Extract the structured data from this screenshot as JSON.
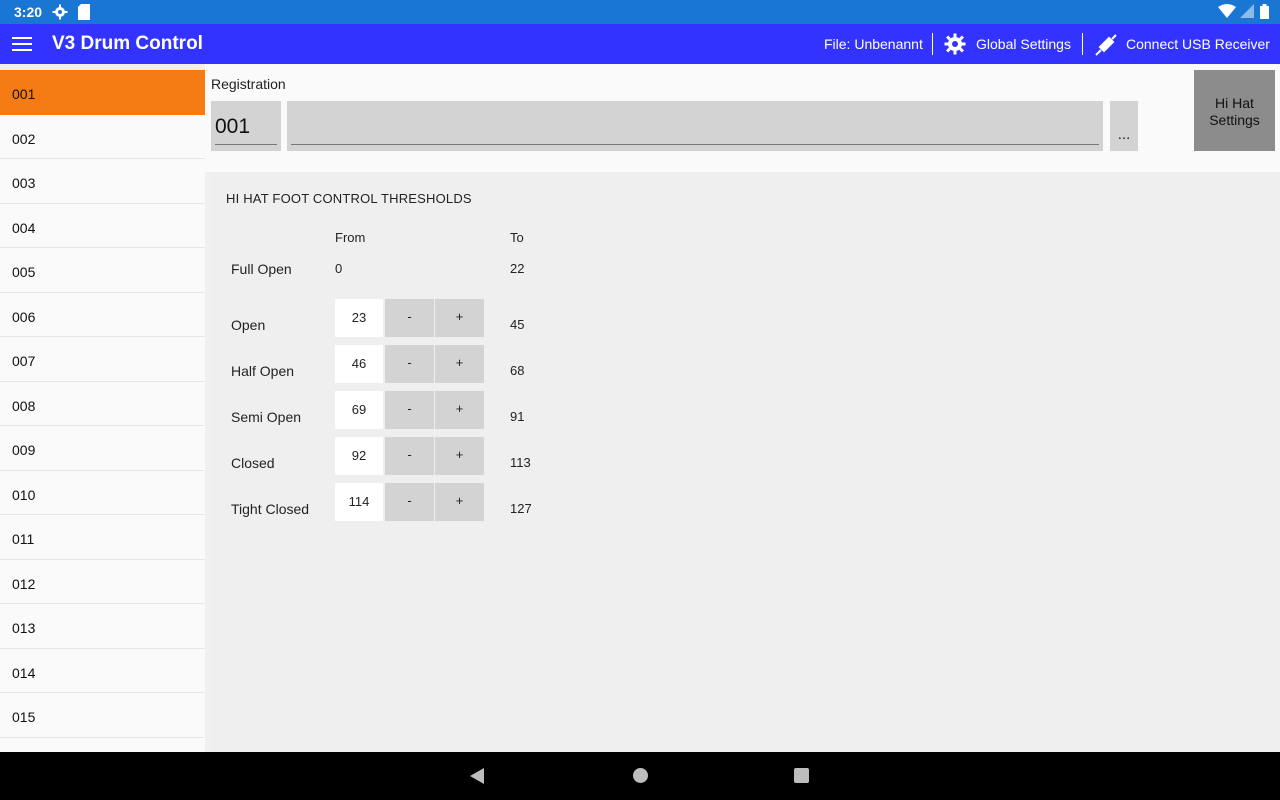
{
  "status_bar": {
    "time": "3:20",
    "icons": [
      "gear-icon",
      "sd-card-icon",
      "wifi-icon",
      "signal-icon",
      "battery-icon"
    ]
  },
  "app_bar": {
    "title": "V3 Drum Control",
    "file_label": "File: Unbenannt",
    "global_settings_label": "Global Settings",
    "connect_usb_label": "Connect USB Receiver",
    "colors": {
      "background": "#3333ff",
      "text": "#ffffff"
    }
  },
  "sidebar": {
    "items": [
      {
        "label": "001",
        "active": true
      },
      {
        "label": "002",
        "active": false
      },
      {
        "label": "003",
        "active": false
      },
      {
        "label": "004",
        "active": false
      },
      {
        "label": "005",
        "active": false
      },
      {
        "label": "006",
        "active": false
      },
      {
        "label": "007",
        "active": false
      },
      {
        "label": "008",
        "active": false
      },
      {
        "label": "009",
        "active": false
      },
      {
        "label": "010",
        "active": false
      },
      {
        "label": "011",
        "active": false
      },
      {
        "label": "012",
        "active": false
      },
      {
        "label": "013",
        "active": false
      },
      {
        "label": "014",
        "active": false
      },
      {
        "label": "015",
        "active": false
      }
    ],
    "active_color": "#f57c14"
  },
  "registration": {
    "label": "Registration",
    "number": "001",
    "name": "",
    "more_button": "...",
    "hihat_button": "Hi Hat Settings"
  },
  "thresholds": {
    "title": "HI HAT FOOT CONTROL THRESHOLDS",
    "col_from": "From",
    "col_to": "To",
    "minus_label": "-",
    "plus_label": "+",
    "rows": [
      {
        "label": "Full Open",
        "from": "0",
        "to": "22",
        "editable": false
      },
      {
        "label": "Open",
        "from": "23",
        "to": "45",
        "editable": true
      },
      {
        "label": "Half Open",
        "from": "46",
        "to": "68",
        "editable": true
      },
      {
        "label": "Semi Open",
        "from": "69",
        "to": "91",
        "editable": true
      },
      {
        "label": "Closed",
        "from": "92",
        "to": "113",
        "editable": true
      },
      {
        "label": "Tight Closed",
        "from": "114",
        "to": "127",
        "editable": true
      }
    ]
  }
}
